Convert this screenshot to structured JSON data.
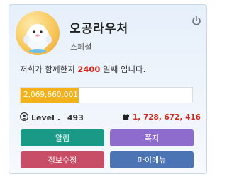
{
  "profile": {
    "nickname": "오공라우처",
    "rank": "스페셜",
    "days_prefix": "저희가 함께한지 ",
    "days_value": "2400",
    "days_suffix": " 일째 입니다."
  },
  "experience": {
    "text": "2,069,660,001 (34%)",
    "percent": 34
  },
  "level": {
    "label": "Level .",
    "value": "493"
  },
  "points": {
    "value": "1, 728, 672, 416"
  },
  "buttons": {
    "alarm": "알림",
    "note": "쪽지",
    "profile_edit": "정보수정",
    "my_menu": "마이메뉴"
  },
  "colors": {
    "accent_red": "#d2281c",
    "progress_fill": "#f3b21b",
    "btn_alarm": "#1a9a86",
    "btn_note": "#8e6ccd",
    "btn_profile": "#c74e66",
    "btn_mymenu": "#4a74b4"
  },
  "icons": {
    "avatar": "avatar",
    "power": "power-icon",
    "user": "user-icon",
    "gift": "gift-icon"
  }
}
